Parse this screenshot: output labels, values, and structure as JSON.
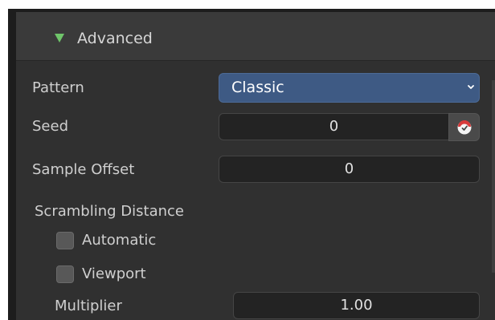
{
  "section": {
    "title": "Advanced"
  },
  "pattern": {
    "label": "Pattern",
    "value": "Classic"
  },
  "seed": {
    "label": "Seed",
    "value": "0"
  },
  "sample_offset": {
    "label": "Sample Offset",
    "value": "0"
  },
  "scrambling": {
    "heading": "Scrambling Distance",
    "automatic_label": "Automatic",
    "automatic_checked": false,
    "viewport_label": "Viewport",
    "viewport_checked": false,
    "multiplier_label": "Multiplier",
    "multiplier_value": "1.00"
  },
  "colors": {
    "accent_green": "#6fc56a",
    "select_blue": "#3e5a84",
    "clock_red": "#d83a3a"
  },
  "icons": {
    "section": "disclosure-triangle-down-icon",
    "select": "chevron-down-icon",
    "seed": "clock-icon"
  }
}
